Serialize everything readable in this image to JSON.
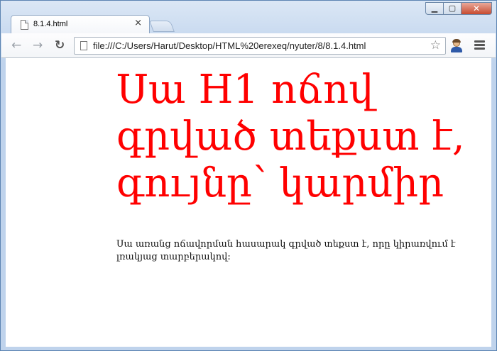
{
  "browser": {
    "tab_title": "8.1.4.html",
    "tab_close": "×",
    "url": "file:///C:/Users/Harut/Desktop/HTML%20erexeq/nyuter/8/8.1.4.html",
    "window_controls": {
      "minimize": "▁",
      "maximize": "▢",
      "close": "✕"
    },
    "nav": {
      "back_icon": "←",
      "forward_icon": "→",
      "reload_icon": "↻",
      "star_icon": "☆"
    }
  },
  "page": {
    "heading": "Սա H1 ոճով գրված տեքստ է, գույնը՝ կարմիր",
    "paragraph": "Սա առանց ոճավորման հասարակ գրված տեքստ է, որը կիրառվում է լռակյաց տարբերակով:",
    "heading_color": "#ff0000"
  }
}
